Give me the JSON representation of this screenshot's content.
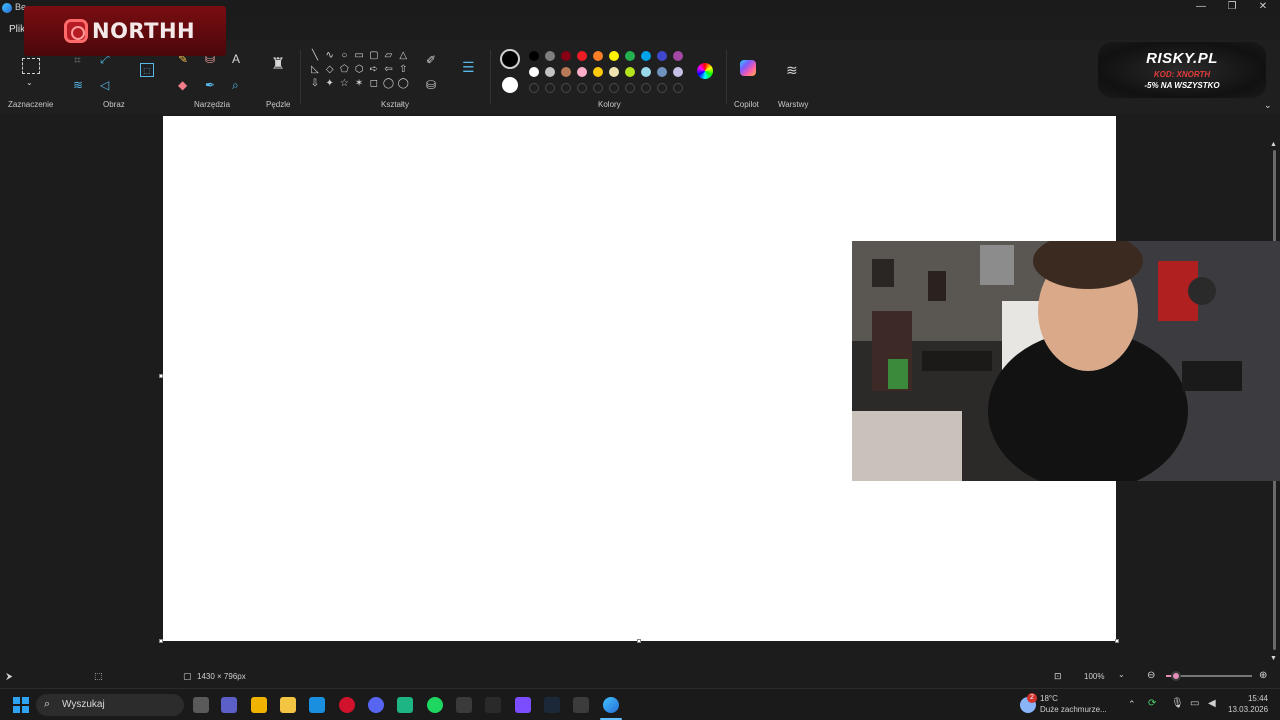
{
  "window": {
    "title": "Be",
    "file_menu": "Plik",
    "controls": [
      "—",
      "❐",
      "✕"
    ]
  },
  "overlay": {
    "instagram_handle": "NORTHH"
  },
  "ribbon": {
    "groups": [
      {
        "key": "selection",
        "label": "Zaznaczenie"
      },
      {
        "key": "image",
        "label": "Obraz"
      },
      {
        "key": "tools",
        "label": "Narzędzia"
      },
      {
        "key": "brushes",
        "label": "Pędzle"
      },
      {
        "key": "shapes",
        "label": "Kształty"
      },
      {
        "key": "colors",
        "label": "Kolory"
      },
      {
        "key": "copilot",
        "label": "Copilot"
      },
      {
        "key": "layers",
        "label": "Warstwy"
      }
    ],
    "shapes_row1": [
      "╲",
      "∿",
      "○",
      "▭",
      "▢",
      "▱",
      "△"
    ],
    "shapes_row2": [
      "◺",
      "◇",
      "⬠",
      "⬡",
      "➪",
      "⇦",
      "⇧"
    ],
    "shapes_row3": [
      "⇩",
      "✦",
      "☆",
      "✶",
      "◻",
      "◯",
      "◯"
    ],
    "colors_row1": [
      "#000000",
      "#7f7f7f",
      "#880015",
      "#ed1c24",
      "#ff7f27",
      "#fff200",
      "#22b14c",
      "#00a2e8",
      "#3f48cc",
      "#a349a4"
    ],
    "colors_row2": [
      "#ffffff",
      "#c3c3c3",
      "#b97a57",
      "#ffaec9",
      "#ffc90e",
      "#efe4b0",
      "#b5e61d",
      "#99d9ea",
      "#7092be",
      "#c8bfe7"
    ]
  },
  "ad": {
    "brand": "RISKY.PL",
    "code": "KOD: XNORTH",
    "promo": "-5% NA WSZYSTKO"
  },
  "status": {
    "canvas_size": "1430 × 796px",
    "zoom": "100%",
    "zoom_level_fraction": 0.12
  },
  "taskbar": {
    "search_placeholder": "Wyszukaj",
    "weather_temp": "18°C",
    "weather_desc": "Duże zachmurze...",
    "weather_badge": "2",
    "time": "15:44",
    "date": "13.03.2026"
  }
}
